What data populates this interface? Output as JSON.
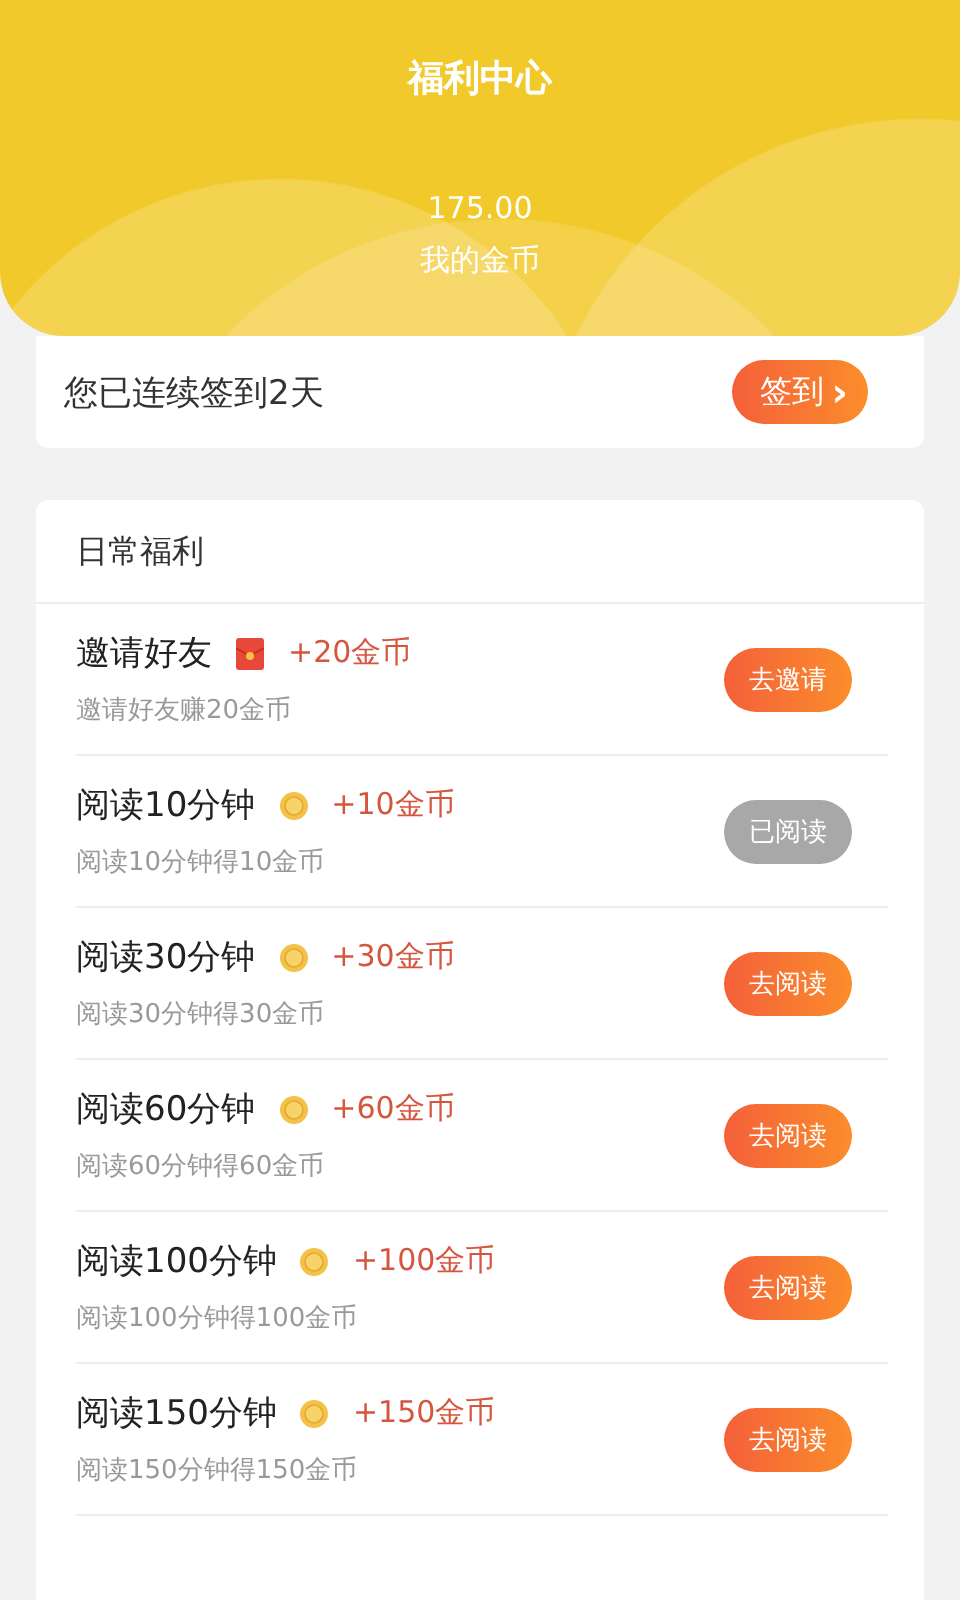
{
  "header": {
    "title": "福利中心",
    "coins": "175.00",
    "coins_label": "我的金币"
  },
  "checkin": {
    "text": "您已连续签到2天",
    "button": "签到",
    "arrow": "›"
  },
  "daily": {
    "heading": "日常福利",
    "tasks": [
      {
        "kind": "invite",
        "title": "邀请好友",
        "reward": "+20金币",
        "desc": "邀请好友赚20金币",
        "button": "去邀请",
        "done": false
      },
      {
        "kind": "read",
        "title": "阅读10分钟",
        "reward": "+10金币",
        "desc": "阅读10分钟得10金币",
        "button": "已阅读",
        "done": true
      },
      {
        "kind": "read",
        "title": "阅读30分钟",
        "reward": "+30金币",
        "desc": "阅读30分钟得30金币",
        "button": "去阅读",
        "done": false
      },
      {
        "kind": "read",
        "title": "阅读60分钟",
        "reward": "+60金币",
        "desc": "阅读60分钟得60金币",
        "button": "去阅读",
        "done": false
      },
      {
        "kind": "read",
        "title": "阅读100分钟",
        "reward": "+100金币",
        "desc": "阅读100分钟得100金币",
        "button": "去阅读",
        "done": false
      },
      {
        "kind": "read",
        "title": "阅读150分钟",
        "reward": "+150金币",
        "desc": "阅读150分钟得150金币",
        "button": "去阅读",
        "done": false
      }
    ]
  }
}
